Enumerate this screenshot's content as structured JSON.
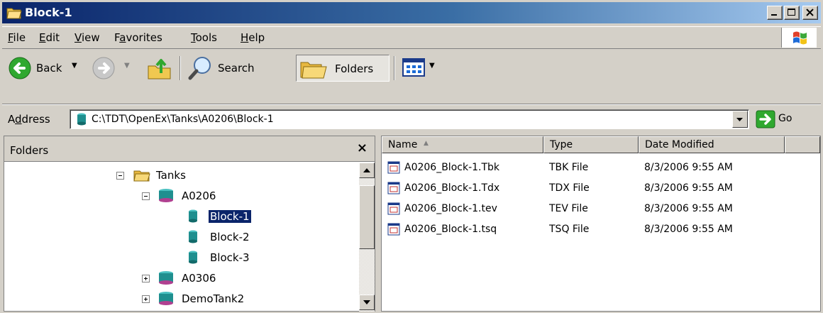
{
  "window": {
    "title": "Block-1"
  },
  "menu": {
    "items": [
      {
        "pre": "",
        "u": "F",
        "post": "ile"
      },
      {
        "pre": "",
        "u": "E",
        "post": "dit"
      },
      {
        "pre": "",
        "u": "V",
        "post": "iew"
      },
      {
        "pre": "F",
        "u": "a",
        "post": "vorites"
      },
      {
        "pre": "",
        "u": "T",
        "post": "ools"
      },
      {
        "pre": "",
        "u": "H",
        "post": "elp"
      }
    ]
  },
  "toolbar": {
    "back_label": "Back",
    "search_label": "Search",
    "folders_label": "Folders"
  },
  "address": {
    "label_pre": "A",
    "label_u": "d",
    "label_post": "dress",
    "value": "C:\\TDT\\OpenEx\\Tanks\\A0206\\Block-1",
    "go_label": "Go"
  },
  "folders": {
    "title": "Folders",
    "close_glyph": "×",
    "tree": [
      {
        "label": "Tanks",
        "expander": "minus",
        "icon": "folder"
      },
      {
        "label": "A0206",
        "expander": "minus",
        "icon": "tank"
      },
      {
        "label": "Block-1",
        "expander": "",
        "icon": "block",
        "selected": true
      },
      {
        "label": "Block-2",
        "expander": "",
        "icon": "block"
      },
      {
        "label": "Block-3",
        "expander": "",
        "icon": "block"
      },
      {
        "label": "A0306",
        "expander": "plus",
        "icon": "tank"
      },
      {
        "label": "DemoTank2",
        "expander": "plus",
        "icon": "tank"
      }
    ]
  },
  "files": {
    "columns": [
      "Name",
      "Type",
      "Date Modified"
    ],
    "sort_indicator": "▲",
    "rows": [
      {
        "name": "A0206_Block-1.Tbk",
        "type": "TBK File",
        "date": "8/3/2006 9:55 AM"
      },
      {
        "name": "A0206_Block-1.Tdx",
        "type": "TDX File",
        "date": "8/3/2006 9:55 AM"
      },
      {
        "name": "A0206_Block-1.tev",
        "type": "TEV File",
        "date": "8/3/2006 9:55 AM"
      },
      {
        "name": "A0206_Block-1.tsq",
        "type": "TSQ File",
        "date": "8/3/2006 9:55 AM"
      }
    ]
  },
  "colors": {
    "title_start": "#0a246a",
    "title_end": "#a6caf0",
    "face": "#d4d0c8",
    "selection": "#0a246a",
    "tank_icon": "#1f8f8f",
    "folder_icon": "#f0c850"
  },
  "icons": [
    "folder-open-icon",
    "back-arrow-icon",
    "forward-arrow-icon",
    "up-folder-icon",
    "search-icon",
    "folders-icon",
    "views-icon",
    "go-arrow-icon",
    "tank-icon",
    "block-icon",
    "file-icon",
    "windows-logo-icon"
  ]
}
